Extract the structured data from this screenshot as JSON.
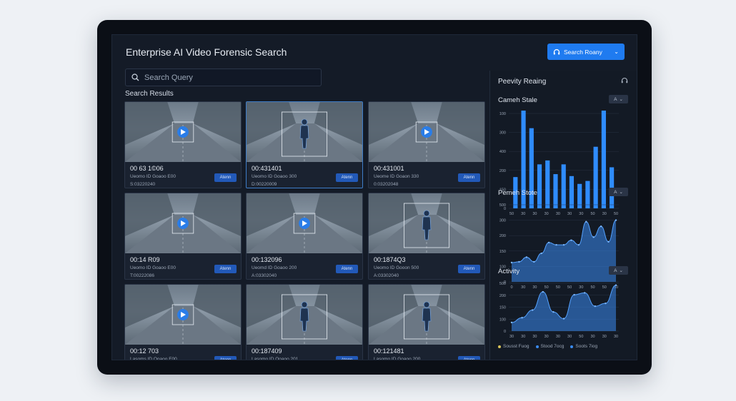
{
  "app": {
    "title": "Enterprise AI Video Forensic Search",
    "primary_button": "Search Roany"
  },
  "search": {
    "placeholder": "Search Query",
    "results_label": "Search Results"
  },
  "cards": [
    {
      "time": "00 63 1©06",
      "meta1": "Ueomo ID Goaoo E00",
      "meta2": "S:03220240",
      "button": "Atenn",
      "figure": "play"
    },
    {
      "time": "00:431401",
      "meta1": "Ueomo ID Goaoo 300",
      "meta2": "D:00220009",
      "button": "Atenn",
      "figure": "person"
    },
    {
      "time": "00:431001",
      "meta1": "Ueome ID Goaon 330",
      "meta2": "0:03202048",
      "button": "Atenn",
      "figure": "play"
    },
    {
      "time": "00:14 R09",
      "meta1": "Ueomo ID Goaoo E00",
      "meta2": "T:00222086",
      "button": "Atenn",
      "figure": "play"
    },
    {
      "time": "00:132096",
      "meta1": "Ueomd ID Goaoo 200",
      "meta2": "A:03302040",
      "button": "Atenn",
      "figure": "play"
    },
    {
      "time": "00:1874Q3",
      "meta1": "Ueomo ID Gooon 500",
      "meta2": "A:03302040",
      "button": "Atenn",
      "figure": "person"
    },
    {
      "time": "00:12 703",
      "meta1": "Lasoms ID Ooaoo E00",
      "meta2": "",
      "button": "Atenn",
      "figure": "play"
    },
    {
      "time": "00:187409",
      "meta1": "Lasomo ID Ooaoo 201",
      "meta2": "",
      "button": "Atenn",
      "figure": "person"
    },
    {
      "time": "00:121481",
      "meta1": "Lasomo ID Goaoo 200",
      "meta2": "",
      "button": "Atenn",
      "figure": "person"
    }
  ],
  "sidebar": {
    "title": "Peevity Reaing",
    "panels": [
      {
        "title": "Cameh Stale",
        "dropdown": "A"
      },
      {
        "title": "Pemeh Stote",
        "dropdown": "A"
      },
      {
        "title": "Activity",
        "dropdown": "A"
      }
    ],
    "legend": [
      {
        "label": "Sousst Fuog",
        "color": "#d9c458"
      },
      {
        "label": "Stood 7ocg",
        "color": "#3a8bf0"
      },
      {
        "label": "Soots 7iog",
        "color": "#3a8bf0"
      }
    ]
  },
  "colors": {
    "accent": "#1f7bf0",
    "bar": "#2f8cff",
    "area": "#3a8bf0"
  },
  "chart_data": [
    {
      "type": "bar",
      "title": "Cameh Stale",
      "yticks": [
        "100",
        "300",
        "400",
        "200",
        "150",
        "0"
      ],
      "xticks": [
        "50",
        "30",
        "30",
        "30",
        "30",
        "30",
        "30",
        "50",
        "30",
        "50"
      ],
      "values": [
        0.32,
        1.0,
        0.82,
        0.45,
        0.49,
        0.35,
        0.45,
        0.33,
        0.25,
        0.28,
        0.63,
        1.0,
        0.42
      ]
    },
    {
      "type": "area",
      "title": "Pemeh Stote",
      "yticks": [
        "500",
        "300",
        "200",
        "150",
        "100",
        "0"
      ],
      "xticks": [
        "0",
        "30",
        "30",
        "50",
        "50",
        "50",
        "30",
        "50",
        "50",
        "50"
      ],
      "values": [
        0.25,
        0.26,
        0.32,
        0.26,
        0.37,
        0.51,
        0.48,
        0.48,
        0.54,
        0.48,
        0.78,
        0.58,
        0.72,
        0.52,
        0.8
      ]
    },
    {
      "type": "area",
      "title": "Activity",
      "yticks": [
        "500",
        "200",
        "150",
        "100",
        "0"
      ],
      "xticks": [
        "30",
        "30",
        "30",
        "30",
        "30",
        "30",
        "50",
        "30",
        "30",
        "30"
      ],
      "values": [
        0.18,
        0.28,
        0.44,
        0.82,
        0.4,
        0.26,
        0.76,
        0.8,
        0.52,
        0.58,
        0.96
      ]
    }
  ]
}
